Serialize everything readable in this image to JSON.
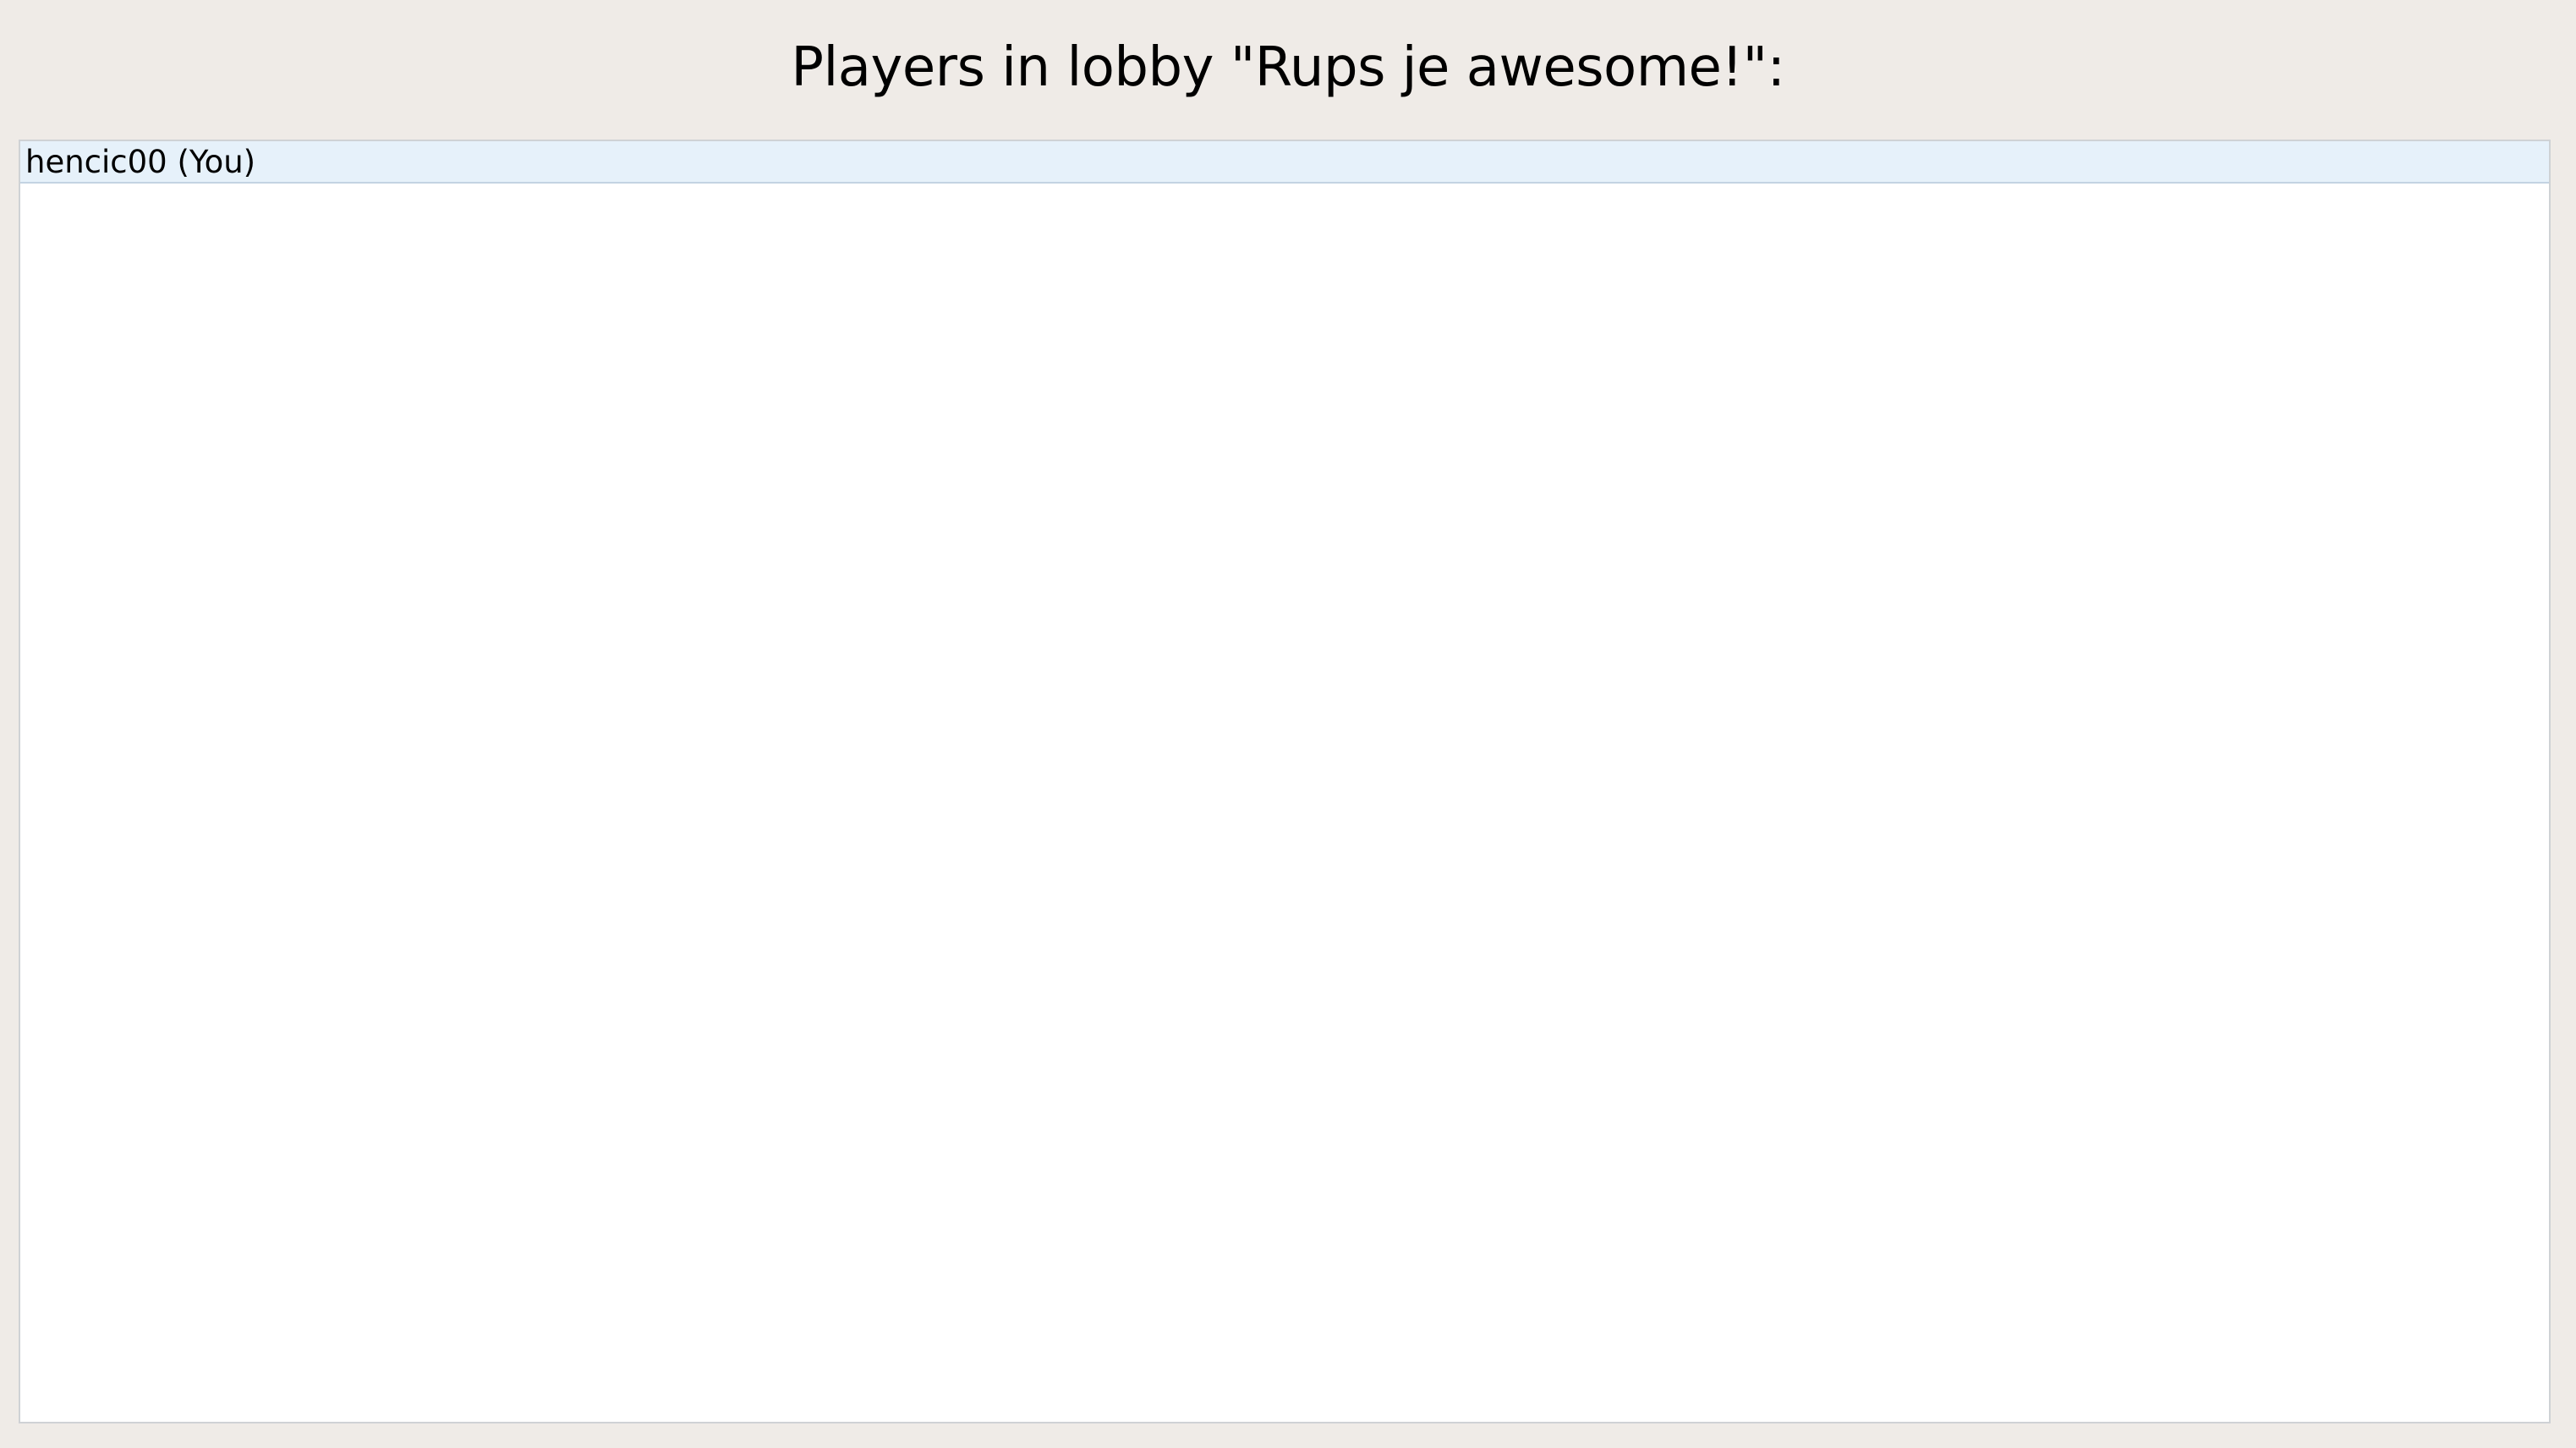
{
  "lobby": {
    "title": "Players in lobby \"Rups je awesome!\":"
  },
  "players": {
    "items": [
      {
        "label": "hencic00 (You)",
        "selected": true
      }
    ]
  },
  "colors": {
    "background": "#efebe7",
    "list_background": "#ffffff",
    "selected_row": "#e6f1fa",
    "list_border": "#cfd2d5"
  }
}
